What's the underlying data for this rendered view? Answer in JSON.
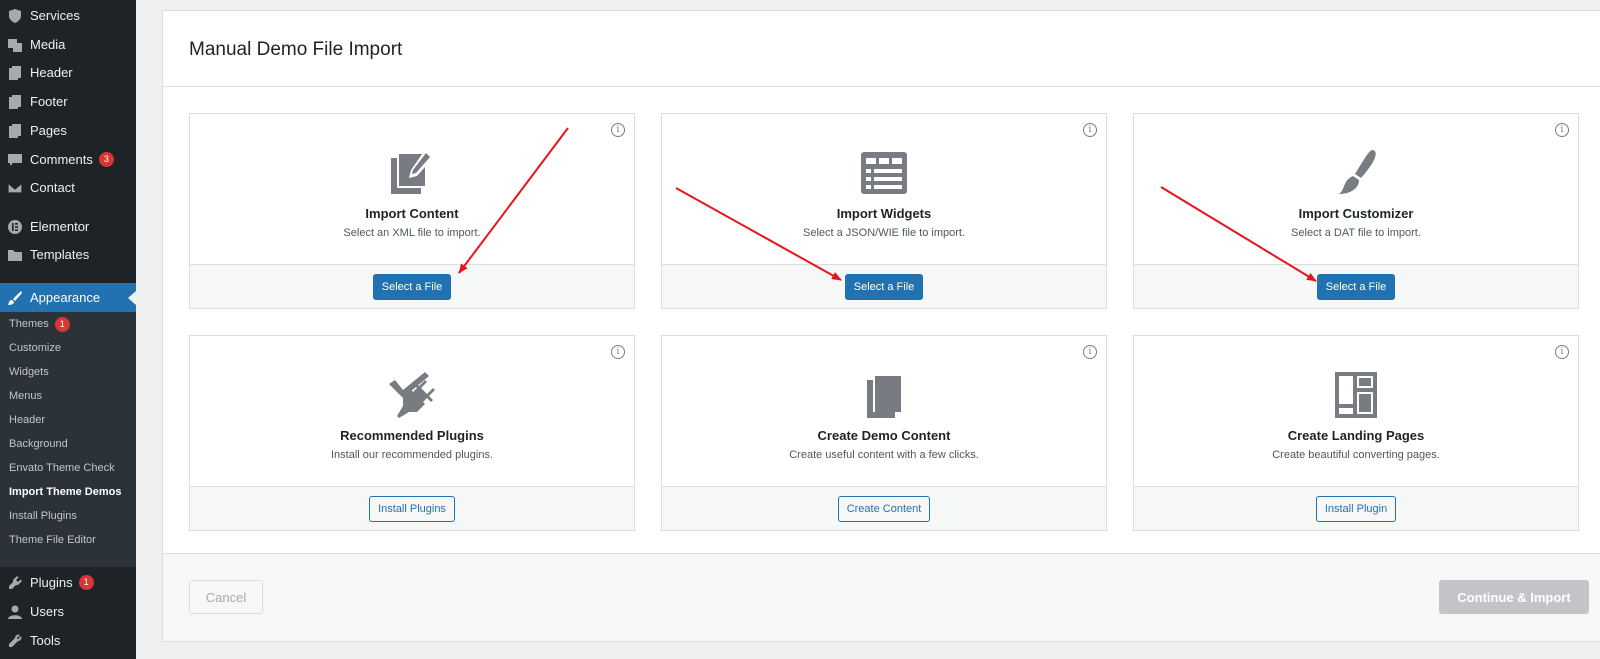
{
  "sidebar": {
    "items": [
      {
        "label": "Services",
        "icon": "shield-icon"
      },
      {
        "label": "Media",
        "icon": "media-icon"
      },
      {
        "label": "Header",
        "icon": "page-icon"
      },
      {
        "label": "Footer",
        "icon": "page-icon"
      },
      {
        "label": "Pages",
        "icon": "page-icon"
      },
      {
        "label": "Comments",
        "icon": "comment-icon",
        "badge": "3"
      },
      {
        "label": "Contact",
        "icon": "envelope-icon"
      },
      {
        "label": "Elementor",
        "icon": "elementor-icon"
      },
      {
        "label": "Templates",
        "icon": "folder-icon"
      }
    ],
    "appearance": {
      "label": "Appearance",
      "icon": "paintbrush-icon"
    },
    "submenu": [
      {
        "label": "Themes",
        "badge": "1"
      },
      {
        "label": "Customize"
      },
      {
        "label": "Widgets"
      },
      {
        "label": "Menus"
      },
      {
        "label": "Header"
      },
      {
        "label": "Background"
      },
      {
        "label": "Envato Theme Check"
      },
      {
        "label": "Import Theme Demos",
        "current": true
      },
      {
        "label": "Install Plugins"
      },
      {
        "label": "Theme File Editor"
      }
    ],
    "bottom": [
      {
        "label": "Plugins",
        "icon": "plug-icon",
        "badge": "1"
      },
      {
        "label": "Users",
        "icon": "user-icon"
      },
      {
        "label": "Tools",
        "icon": "wrench-icon"
      }
    ]
  },
  "panel": {
    "title": "Manual Demo File Import",
    "info_glyph": "i",
    "cards": [
      {
        "title": "Import Content",
        "desc": "Select an XML file to import.",
        "button": "Select a File",
        "style": "primary",
        "icon": "import-content-icon"
      },
      {
        "title": "Import Widgets",
        "desc": "Select a JSON/WIE file to import.",
        "button": "Select a File",
        "style": "primary",
        "icon": "widgets-icon"
      },
      {
        "title": "Import Customizer",
        "desc": "Select a DAT file to import.",
        "button": "Select a File",
        "style": "primary",
        "icon": "brush-icon"
      },
      {
        "title": "Recommended Plugins",
        "desc": "Install our recommended plugins.",
        "button": "Install Plugins",
        "style": "secondary",
        "icon": "plugin-check-icon"
      },
      {
        "title": "Create Demo Content",
        "desc": "Create useful content with a few clicks.",
        "button": "Create Content",
        "style": "secondary",
        "icon": "copy-icon"
      },
      {
        "title": "Create Landing Pages",
        "desc": "Create beautiful converting pages.",
        "button": "Install Plugin",
        "style": "secondary",
        "icon": "layout-icon"
      }
    ],
    "cancel_label": "Cancel",
    "continue_label": "Continue & Import"
  },
  "colors": {
    "accent": "#2271b1",
    "annotation_arrow": "#e8141b",
    "badge": "#d63638",
    "sidebar_bg": "#1d2327"
  }
}
